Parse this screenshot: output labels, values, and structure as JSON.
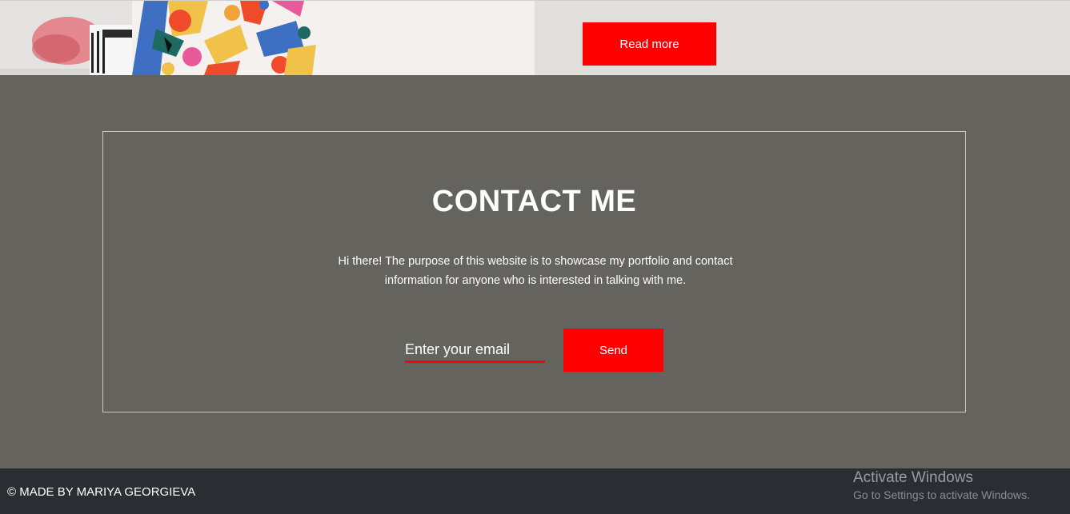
{
  "hero": {
    "read_more_label": "Read more"
  },
  "contact": {
    "title": "CONTACT ME",
    "description": "Hi there! The purpose of this website is to showcase my portfolio and contact information for anyone who is interested in talking with me.",
    "email_placeholder": "Enter your email",
    "email_value": "",
    "send_label": "Send"
  },
  "footer": {
    "copyright": "© MADE BY MARIYA GEORGIEVA"
  },
  "watermark": {
    "title": "Activate Windows",
    "subtitle": "Go to Settings to activate Windows."
  },
  "colors": {
    "accent": "#ff0000",
    "section_bg": "#64635d",
    "footer_bg": "#2a2d31"
  }
}
